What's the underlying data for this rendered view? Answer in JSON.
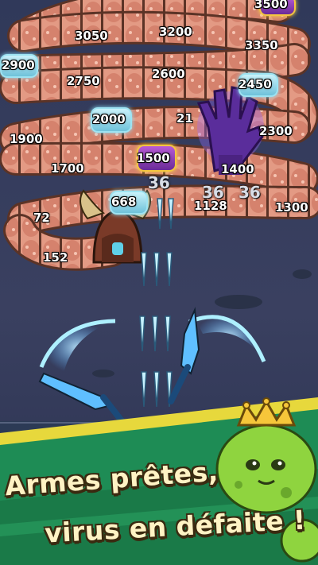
{
  "enemy_values": [
    {
      "label": "3500"
    },
    {
      "label": "3050"
    },
    {
      "label": "3200"
    },
    {
      "label": "3350"
    },
    {
      "label": "2900"
    },
    {
      "label": "2750"
    },
    {
      "label": "2600"
    },
    {
      "label": "2450"
    },
    {
      "label": "2000"
    },
    {
      "label": "21"
    },
    {
      "label": "2300"
    },
    {
      "label": "1900"
    },
    {
      "label": "1700"
    },
    {
      "label": "1500"
    },
    {
      "label": "1400"
    },
    {
      "label": "668"
    },
    {
      "label": "1128"
    },
    {
      "label": "1300"
    },
    {
      "label": "72"
    },
    {
      "label": "152"
    }
  ],
  "damage_numbers": [
    "36",
    "36",
    "36"
  ],
  "caption": {
    "line1": "Armes prêtes,",
    "line2": "virus en défaite !"
  },
  "colors": {
    "worm_body": "#e0917a",
    "worm_stripe": "#5b3326",
    "projectile": "#bfeefa",
    "blade": "#6fd3ff",
    "slime": "#9fe04a",
    "crown": "#f6c63a",
    "hand": "#6a3fb5"
  },
  "icons": [
    "horned-boss-icon",
    "purple-hand-icon",
    "heart-icon",
    "slime-king-icon",
    "crown-icon"
  ]
}
